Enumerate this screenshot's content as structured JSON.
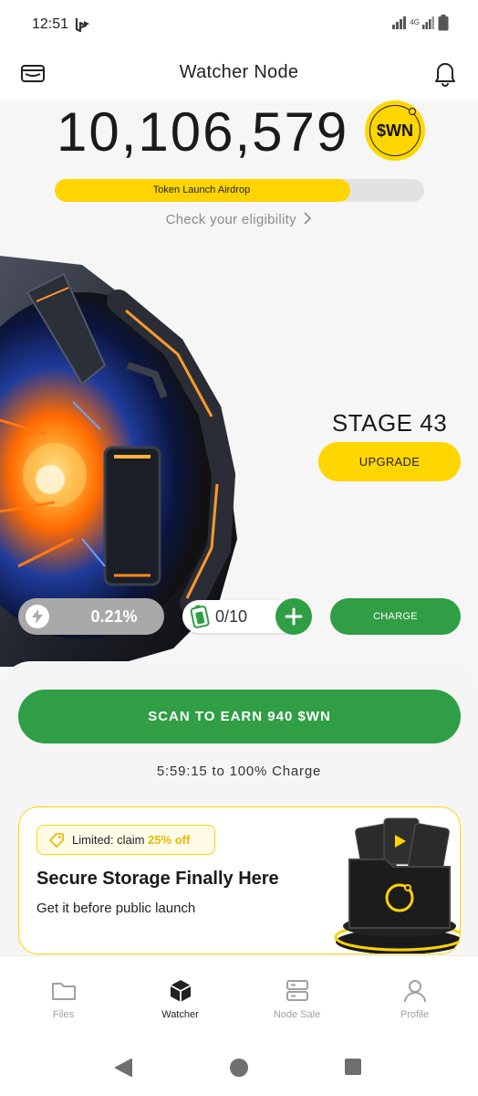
{
  "status_bar": {
    "time": "12:51",
    "network_label": "4G"
  },
  "header": {
    "title": "Watcher Node"
  },
  "balance": {
    "amount": "10,106,579",
    "token_symbol": "$WN"
  },
  "airdrop": {
    "label": "Token Launch Airdrop",
    "progress_percent": 80,
    "link_text": "Check your eligibility"
  },
  "node": {
    "stage_label": "STAGE 43",
    "upgrade_label": "UPGRADE",
    "power_value": "0.21%",
    "battery_count": "0/10",
    "charge_label": "CHARGE"
  },
  "scan": {
    "button_label": "SCAN TO EARN 940 $WN",
    "timer_value": "5:59:15",
    "timer_suffix": "to 100% Charge"
  },
  "promo": {
    "badge_prefix": "Limited: claim",
    "badge_highlight": "25% off",
    "title": "Secure Storage Finally Here",
    "subtitle": "Get it before public launch"
  },
  "bottom_nav": {
    "items": [
      {
        "label": "Files",
        "icon": "folder-icon"
      },
      {
        "label": "Watcher",
        "icon": "cube-icon"
      },
      {
        "label": "Node Sale",
        "icon": "server-icon"
      },
      {
        "label": "Profile",
        "icon": "person-icon"
      }
    ],
    "active": "Watcher"
  },
  "colors": {
    "accent_yellow": "#ffd600",
    "accent_green": "#2f9e44",
    "page_bg": "#f6f6f6",
    "muted_text": "#8a8a8a"
  }
}
